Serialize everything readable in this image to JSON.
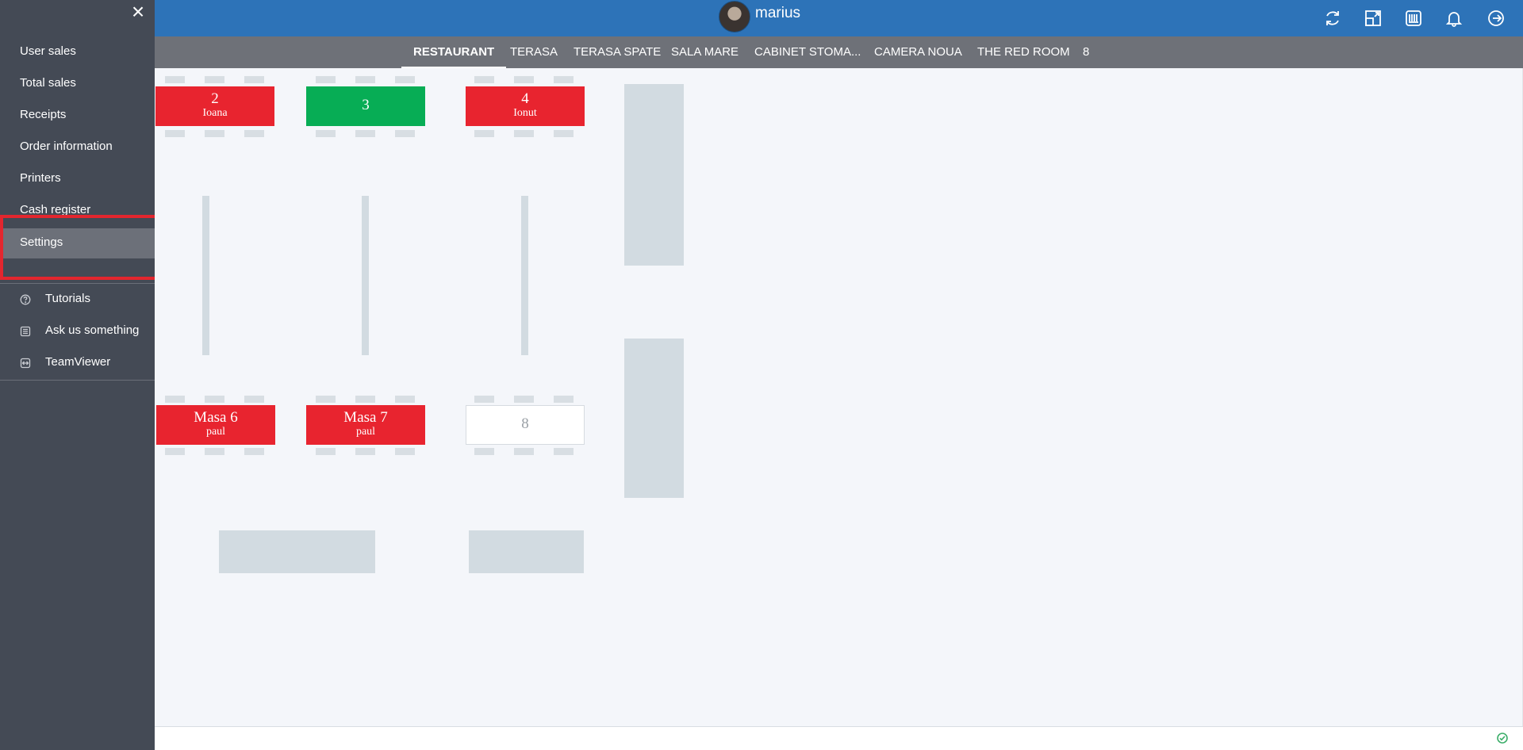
{
  "header": {
    "username": "marius",
    "icons": [
      "sync-icon",
      "resize-icon",
      "stack-icon",
      "bell-icon",
      "logout-icon"
    ]
  },
  "tabs": [
    {
      "label": "RESTAURANT",
      "active": true
    },
    {
      "label": "TERASA",
      "active": false
    },
    {
      "label": "TERASA SPATE",
      "active": false
    },
    {
      "label": "SALA MARE",
      "active": false
    },
    {
      "label": "CABINET STOMA...",
      "active": false
    },
    {
      "label": "CAMERA NOUA",
      "active": false
    },
    {
      "label": "THE RED ROOM",
      "active": false
    },
    {
      "label": "8",
      "active": false
    }
  ],
  "sidebar": {
    "close_label": "×",
    "items": [
      {
        "label": "User sales"
      },
      {
        "label": "Total sales"
      },
      {
        "label": "Receipts"
      },
      {
        "label": "Order information"
      },
      {
        "label": "Printers"
      },
      {
        "label": "Cash register"
      },
      {
        "label": "Settings",
        "selected": true
      }
    ],
    "help_items": [
      {
        "label": "Tutorials",
        "icon": "question-circle-icon"
      },
      {
        "label": "Ask us something",
        "icon": "chat-icon"
      },
      {
        "label": "TeamViewer",
        "icon": "teamviewer-icon"
      }
    ]
  },
  "tables": [
    {
      "number": "2",
      "server": "Ioana",
      "status": "occupied",
      "color": "#e8242f"
    },
    {
      "number": "3",
      "server": "",
      "status": "ready",
      "color": "#07ad55"
    },
    {
      "number": "4",
      "server": "Ionut",
      "status": "occupied",
      "color": "#e8242f"
    },
    {
      "number": "Masa 6",
      "server": "paul",
      "status": "occupied",
      "color": "#e8242f"
    },
    {
      "number": "Masa 7",
      "server": "paul",
      "status": "occupied",
      "color": "#e8242f"
    },
    {
      "number": "8",
      "server": "",
      "status": "free",
      "color": "#ffffff"
    }
  ],
  "colors": {
    "topbar": "#2d73b8",
    "tabbar": "#6e7178",
    "sidebar": "#444a55",
    "highlight": "#e3262e"
  }
}
